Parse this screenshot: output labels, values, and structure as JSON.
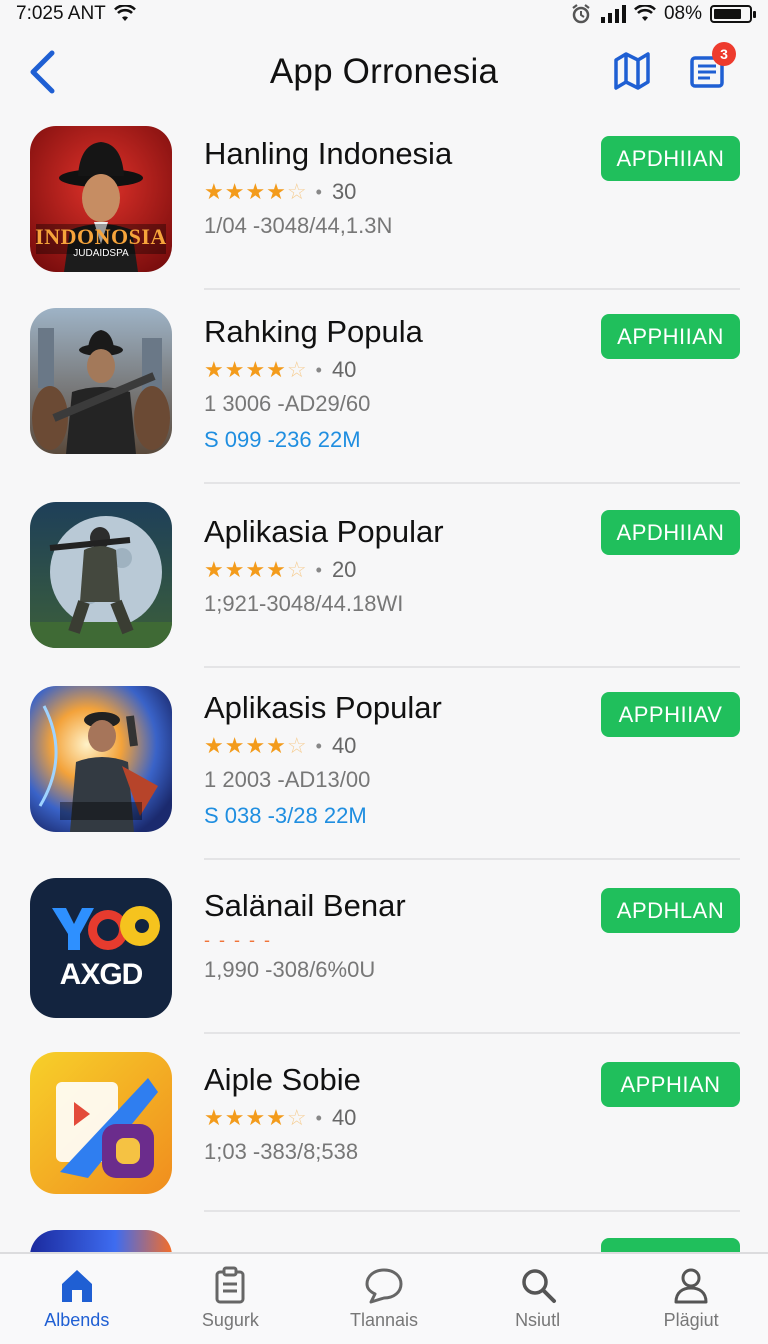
{
  "status_bar": {
    "time": "7:025 ANT",
    "battery": "08%"
  },
  "header": {
    "title": "App Orronesia",
    "notification_count": "3"
  },
  "apps": [
    {
      "name": "Hanling Indonesia",
      "rating": "30",
      "meta": "1/04 -3048/44,1.3N",
      "price": "",
      "button": "APDHIIAN",
      "icon": "indonesia-hat-man-icon",
      "icon_text": "INDONOSIA",
      "icon_subtext": "JUDAIDSPA"
    },
    {
      "name": "Rahking Popula",
      "rating": "40",
      "meta": "1 3006 -AD29/60",
      "price": "S 099 -236 22M",
      "button": "APPHIIAN",
      "icon": "soldier-rifle-icon"
    },
    {
      "name": "Aplikasia Popular",
      "rating": "20",
      "meta": "1;921-3048/44.18WI",
      "price": "",
      "button": "APDHIIAN",
      "icon": "soldier-moon-icon"
    },
    {
      "name": "Aplikasis Popular",
      "rating": "40",
      "meta": "1 2003 -AD13/00",
      "price": "S 038 -3/28 22M",
      "button": "APPHIIAV",
      "icon": "hero-explosion-icon"
    },
    {
      "name": "Salänail Benar",
      "rating": "",
      "meta": "1,990 -308/6%0U",
      "price": "",
      "button": "APDHLAN",
      "icon": "yo-axgd-logo-icon",
      "icon_text": "AXGD",
      "dashes": "- - - - -"
    },
    {
      "name": "Aiple Sobie",
      "rating": "40",
      "meta": "1;03 -383/8;538",
      "price": "",
      "button": "APPHIAN",
      "icon": "colorful-o-logo-icon"
    }
  ],
  "tabs": [
    {
      "label": "Albends",
      "icon": "home-icon",
      "active": true
    },
    {
      "label": "Sugurk",
      "icon": "clipboard-icon",
      "active": false
    },
    {
      "label": "Tlannais",
      "icon": "chat-bubble-icon",
      "active": false
    },
    {
      "label": "Nsiutl",
      "icon": "search-icon",
      "active": false
    },
    {
      "label": "Plägiut",
      "icon": "profile-icon",
      "active": false
    }
  ]
}
